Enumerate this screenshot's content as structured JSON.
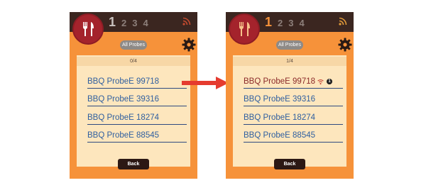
{
  "colors": {
    "screen_background": "#f6923a",
    "topbar": "#3b2620",
    "logo": "#a4232c",
    "panel": "#fde6bd",
    "probe_text": "#2f5fa0",
    "probe_selected_text": "#8b2a2a",
    "arrow": "#e53b2f"
  },
  "icons": {
    "logo": "fork-knife-icon",
    "feed": "rss-icon",
    "settings": "gear-icon",
    "signal": "wifi-signal-icon"
  },
  "left": {
    "tabs": [
      "1",
      "2",
      "3",
      "4"
    ],
    "active_tab": "1",
    "filter_label": "All Probes",
    "count": "0/4",
    "probes": [
      "BBQ ProbeE 99718",
      "BBQ ProbeE 39316",
      "BBQ ProbeE 18274",
      "BBQ ProbeE 88545"
    ],
    "back_label": "Back"
  },
  "right": {
    "tabs": [
      "1",
      "2",
      "3",
      "4"
    ],
    "active_tab": "1",
    "filter_label": "All Probes",
    "count": "1/4",
    "probes": [
      "BBQ ProbeE 99718",
      "BBQ ProbeE 39316",
      "BBQ ProbeE 18274",
      "BBQ ProbeE 88545"
    ],
    "selected_probe_badge": "1",
    "back_label": "Back"
  }
}
